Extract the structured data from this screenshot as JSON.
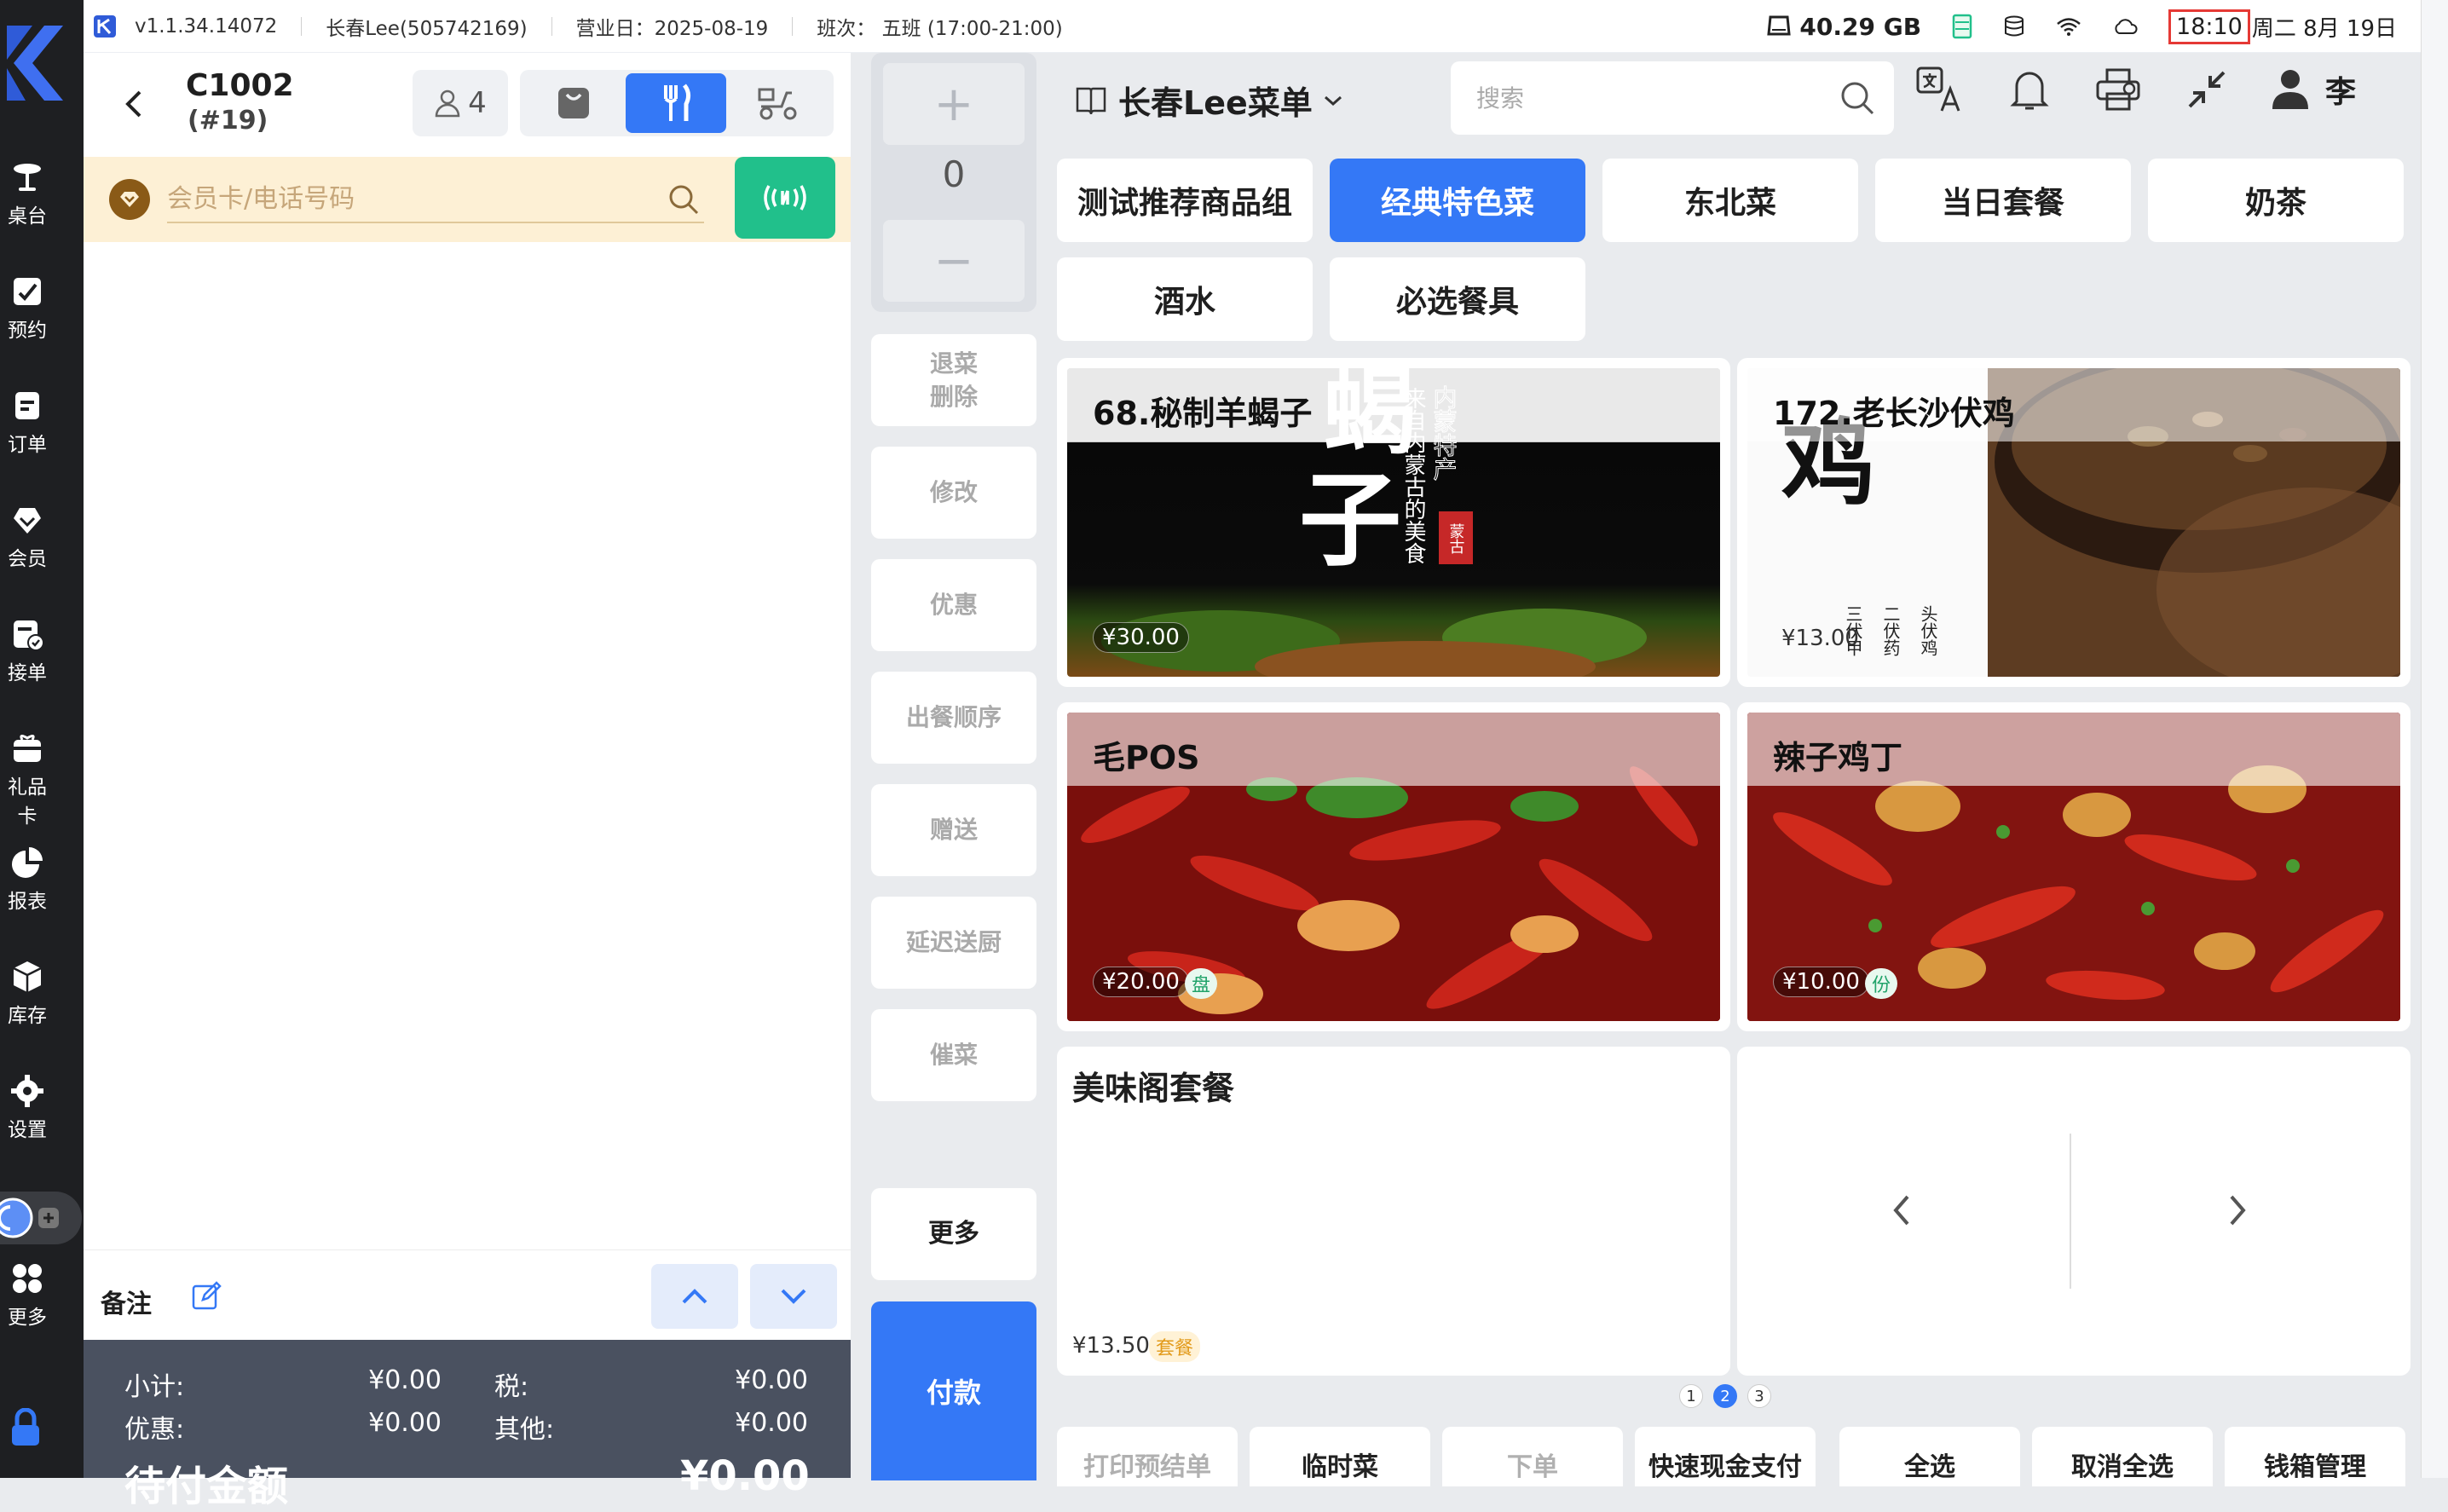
{
  "statusbar": {
    "version": "v1.1.34.14072",
    "store": "长春Lee(505742169)",
    "business_day": "营业日：2025-08-19",
    "shift": "班次：  五班 (17:00-21:00)",
    "storage": "40.29 GB",
    "time": "18:10",
    "date": "周二 8月 19日"
  },
  "nav": {
    "items": [
      {
        "label": "桌台",
        "icon": "table-icon"
      },
      {
        "label": "预约",
        "icon": "reservation-icon"
      },
      {
        "label": "订单",
        "icon": "order-icon"
      },
      {
        "label": "会员",
        "icon": "member-icon"
      },
      {
        "label": "接单",
        "icon": "accept-order-icon"
      },
      {
        "label": "礼品卡",
        "icon": "gift-card-icon"
      },
      {
        "label": "报表",
        "icon": "report-icon"
      },
      {
        "label": "库存",
        "icon": "inventory-icon"
      },
      {
        "label": "设置",
        "icon": "settings-icon"
      },
      {
        "label": "更多",
        "icon": "more-icon"
      }
    ]
  },
  "order": {
    "table_code": "C1002",
    "order_no": "(#19)",
    "guests": "4",
    "member_placeholder": "会员卡/电话号码",
    "note_label": "备注",
    "summary": {
      "subtotal_label": "小计:",
      "subtotal": "¥0.00",
      "tax_label": "税:",
      "tax": "¥0.00",
      "discount_label": "优惠:",
      "discount": "¥0.00",
      "other_label": "其他:",
      "other": "¥0.00",
      "due_label": "待付金额",
      "due": "¥0.00"
    }
  },
  "ops": {
    "quantity": "0",
    "buttons": [
      "退菜\n删除",
      "修改",
      "优惠",
      "出餐顺序",
      "赠送",
      "延迟送厨",
      "催菜"
    ],
    "more": "更多",
    "pay": "付款"
  },
  "menu": {
    "title": "长春Lee菜单",
    "search_placeholder": "搜索",
    "user": "李",
    "categories": [
      "测试推荐商品组",
      "经典特色菜",
      "东北菜",
      "当日套餐",
      "奶茶",
      "酒水",
      "必选餐具"
    ],
    "active_category": 1,
    "dishes": [
      {
        "name": "68.秘制羊蝎子",
        "price": "¥30.00",
        "unit": ""
      },
      {
        "name": "172.老长沙伏鸡",
        "price": "¥13.00",
        "unit": ""
      },
      {
        "name": "毛POS",
        "price": "¥20.00",
        "unit": "盘"
      },
      {
        "name": "辣子鸡丁",
        "price": "¥10.00",
        "unit": "份"
      },
      {
        "name": "美味阁套餐",
        "price": "¥13.50",
        "unit": "套餐"
      }
    ],
    "dish_art": {
      "big_char_1": "蝎",
      "big_char_2": "子",
      "vertical_text": "来自内蒙古的美食",
      "circle_text": "内蒙特产",
      "seal": "蒙古",
      "chicken_char": "鸡",
      "small_lines": [
        "头伏鸡",
        "二伏药",
        "三伏甲"
      ]
    },
    "pages": [
      "1",
      "2",
      "3"
    ],
    "active_page": 1
  },
  "bottom_actions": [
    "打印预结单",
    "临时菜",
    "下单",
    "快速现金支付",
    "全选",
    "取消全选",
    "钱箱管理"
  ],
  "colors": {
    "primary": "#3478f6",
    "nfc": "#21c08b",
    "member_bar": "#fdf0d5",
    "nav_bg": "#1e1f22",
    "summary_bg": "#4a5160"
  }
}
